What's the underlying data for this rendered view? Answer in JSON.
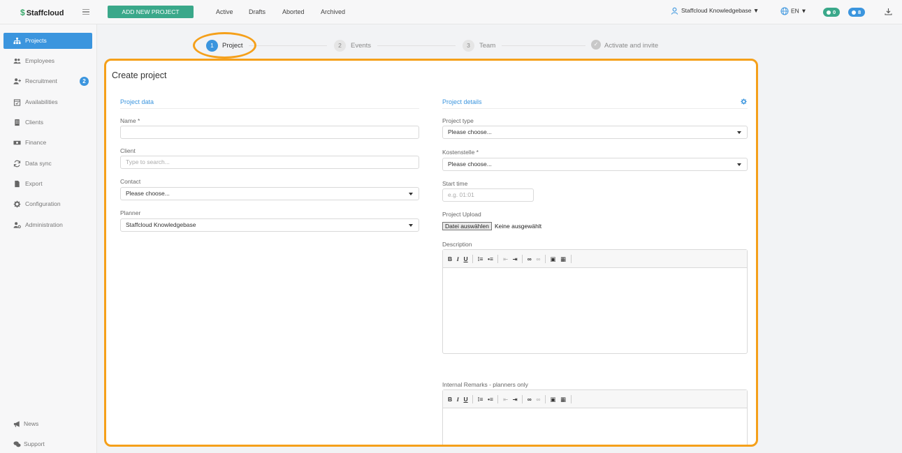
{
  "brand": {
    "name": "Staffcloud",
    "accent": "#3aa86b"
  },
  "topbar": {
    "add_button": "ADD NEW PROJECT",
    "nav": [
      "Active",
      "Drafts",
      "Aborted",
      "Archived"
    ],
    "user": "Staffcloud Knowledgebase",
    "lang": "EN",
    "count_a": "0",
    "count_b": "8"
  },
  "sidebar": {
    "items": [
      {
        "label": "Projects",
        "icon": "sitemap-icon"
      },
      {
        "label": "Employees",
        "icon": "users-icon"
      },
      {
        "label": "Recruitment",
        "icon": "user-plus-icon",
        "badge": "2"
      },
      {
        "label": "Availabilities",
        "icon": "calendar-check-icon"
      },
      {
        "label": "Clients",
        "icon": "building-icon"
      },
      {
        "label": "Finance",
        "icon": "money-icon"
      },
      {
        "label": "Data sync",
        "icon": "sync-icon"
      },
      {
        "label": "Export",
        "icon": "file-icon"
      },
      {
        "label": "Configuration",
        "icon": "gear-icon"
      },
      {
        "label": "Administration",
        "icon": "user-cog-icon"
      }
    ],
    "bottom": [
      {
        "label": "News",
        "icon": "megaphone-icon"
      },
      {
        "label": "Support",
        "icon": "chat-icon"
      }
    ]
  },
  "steps": [
    {
      "num": "1",
      "label": "Project"
    },
    {
      "num": "2",
      "label": "Events"
    },
    {
      "num": "3",
      "label": "Team"
    },
    {
      "num": "✓",
      "label": "Activate and invite"
    }
  ],
  "form": {
    "title": "Create project",
    "left_section": "Project data",
    "right_section": "Project details",
    "name_label": "Name *",
    "client_label": "Client",
    "client_placeholder": "Type to search...",
    "contact_label": "Contact",
    "contact_value": "Please choose...",
    "planner_label": "Planner",
    "planner_value": "Staffcloud Knowledgebase",
    "type_label": "Project type",
    "type_value": "Please choose...",
    "cost_label": "Kostenstelle *",
    "cost_value": "Please choose...",
    "start_label": "Start time",
    "start_placeholder": "e.g. 01:01",
    "upload_label": "Project Upload",
    "upload_button": "Datei auswählen",
    "upload_status": "Keine ausgewählt",
    "desc_label": "Description",
    "remarks_label": "Internal Remarks - planners only",
    "toolbar": {
      "bold": "B",
      "italic": "I",
      "underline": "U"
    }
  }
}
